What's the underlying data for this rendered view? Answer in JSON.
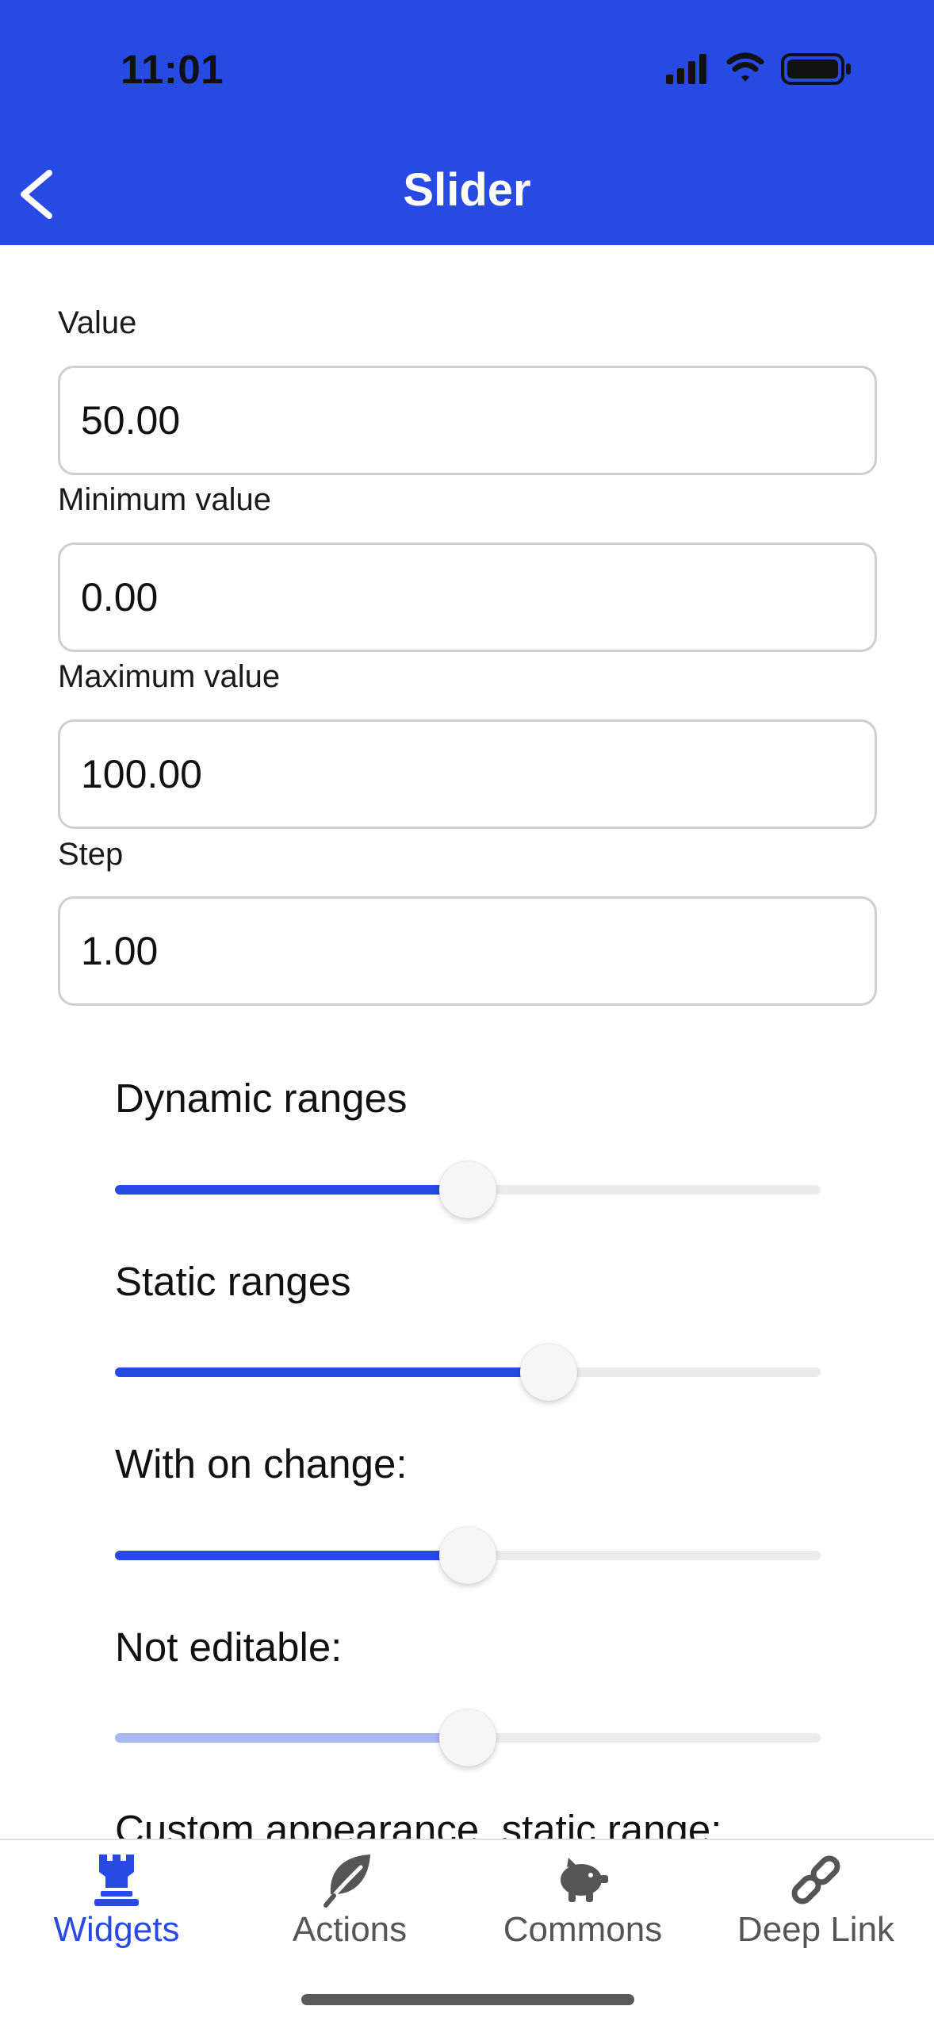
{
  "status_bar": {
    "time": "11:01",
    "icons": [
      "signal-icon",
      "wifi-icon",
      "battery-icon"
    ]
  },
  "nav": {
    "title": "Slider",
    "back_icon": "chevron-left-icon"
  },
  "form": {
    "value": {
      "label": "Value",
      "input": "50.00"
    },
    "minimum": {
      "label": "Minimum value",
      "input": "0.00"
    },
    "maximum": {
      "label": "Maximum value",
      "input": "100.00"
    },
    "step": {
      "label": "Step",
      "input": "1.00"
    }
  },
  "sliders": [
    {
      "label": "Dynamic ranges",
      "fraction": 0.5,
      "enabled": true
    },
    {
      "label": "Static ranges",
      "fraction": 0.615,
      "enabled": true
    },
    {
      "label": "With on change:",
      "fraction": 0.5,
      "enabled": true
    },
    {
      "label": "Not editable:",
      "fraction": 0.5,
      "enabled": false
    }
  ],
  "partial_label": "Custom appearance, static range:",
  "tabs": [
    {
      "label": "Widgets",
      "icon": "chess-rook-icon",
      "active": true
    },
    {
      "label": "Actions",
      "icon": "leaf-icon",
      "active": false
    },
    {
      "label": "Commons",
      "icon": "piggy-bank-icon",
      "active": false
    },
    {
      "label": "Deep Link",
      "icon": "link-icon",
      "active": false
    }
  ],
  "colors": {
    "accent": "#284ae4",
    "accent_disabled": "#a9b7f2",
    "track": "#ececec",
    "input_border": "#cfcfcf",
    "tab_inactive": "#555555"
  }
}
